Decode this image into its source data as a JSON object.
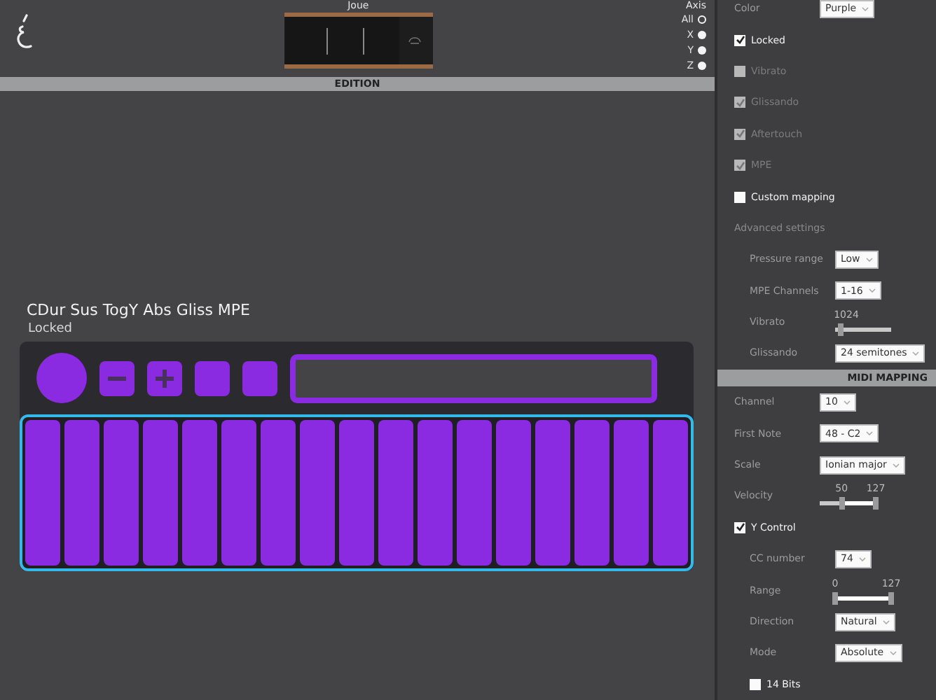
{
  "header": {
    "device_title": "Joue",
    "axis": {
      "title": "Axis",
      "options": [
        {
          "label": "All",
          "selected": true
        },
        {
          "label": "X",
          "selected": false
        },
        {
          "label": "Y",
          "selected": false
        },
        {
          "label": "Z",
          "selected": false
        }
      ]
    }
  },
  "edition_bar": {
    "title": "EDITION"
  },
  "preset": {
    "name": "CDur Sus TogY Abs Gliss MPE",
    "status": "Locked"
  },
  "settings": [
    {
      "kind": "select",
      "label": "Color",
      "value": "Purple"
    },
    {
      "kind": "checkbox",
      "label": "Locked",
      "checked": true,
      "disabled": false
    },
    {
      "kind": "checkbox",
      "label": "Vibrato",
      "checked": false,
      "disabled": true
    },
    {
      "kind": "checkbox",
      "label": "Glissando",
      "checked": true,
      "disabled": true
    },
    {
      "kind": "checkbox",
      "label": "Aftertouch",
      "checked": true,
      "disabled": true
    },
    {
      "kind": "checkbox",
      "label": "MPE",
      "checked": true,
      "disabled": true
    },
    {
      "kind": "checkbox",
      "label": "Custom mapping",
      "checked": false,
      "disabled": false
    },
    {
      "kind": "group",
      "label": "Advanced settings",
      "children": [
        {
          "kind": "select",
          "label": "Pressure range",
          "value": "Low"
        },
        {
          "kind": "select",
          "label": "MPE Channels",
          "value": "1-16"
        },
        {
          "kind": "slider",
          "label": "Vibrato",
          "reading": "1024",
          "level": 0.1
        },
        {
          "kind": "select",
          "label": "Glissando",
          "value": "24 semitones"
        }
      ]
    }
  ],
  "midi_mapping": {
    "title": "MIDI MAPPING",
    "rows": [
      {
        "kind": "select",
        "label": "Channel",
        "value": "10"
      },
      {
        "kind": "select",
        "label": "First Note",
        "value": "48 - C2"
      },
      {
        "kind": "select",
        "label": "Scale",
        "value": "Ionian major"
      },
      {
        "kind": "range",
        "label": "Velocity",
        "low": {
          "reading": "50",
          "level": 0.39
        },
        "high": {
          "reading": "127",
          "level": 1
        }
      },
      {
        "kind": "checkbox",
        "label": "Y Control",
        "checked": true,
        "disabled": false,
        "children": [
          {
            "kind": "select",
            "label": "CC number",
            "value": "74"
          },
          {
            "kind": "range",
            "label": "Range",
            "low": {
              "reading": "0",
              "level": 0
            },
            "high": {
              "reading": "127",
              "level": 1
            }
          },
          {
            "kind": "select",
            "label": "Direction",
            "value": "Natural"
          },
          {
            "kind": "select",
            "label": "Mode",
            "value": "Absolute"
          },
          {
            "kind": "checkbox",
            "label": "14 Bits",
            "checked": false,
            "disabled": false
          }
        ]
      }
    ]
  }
}
